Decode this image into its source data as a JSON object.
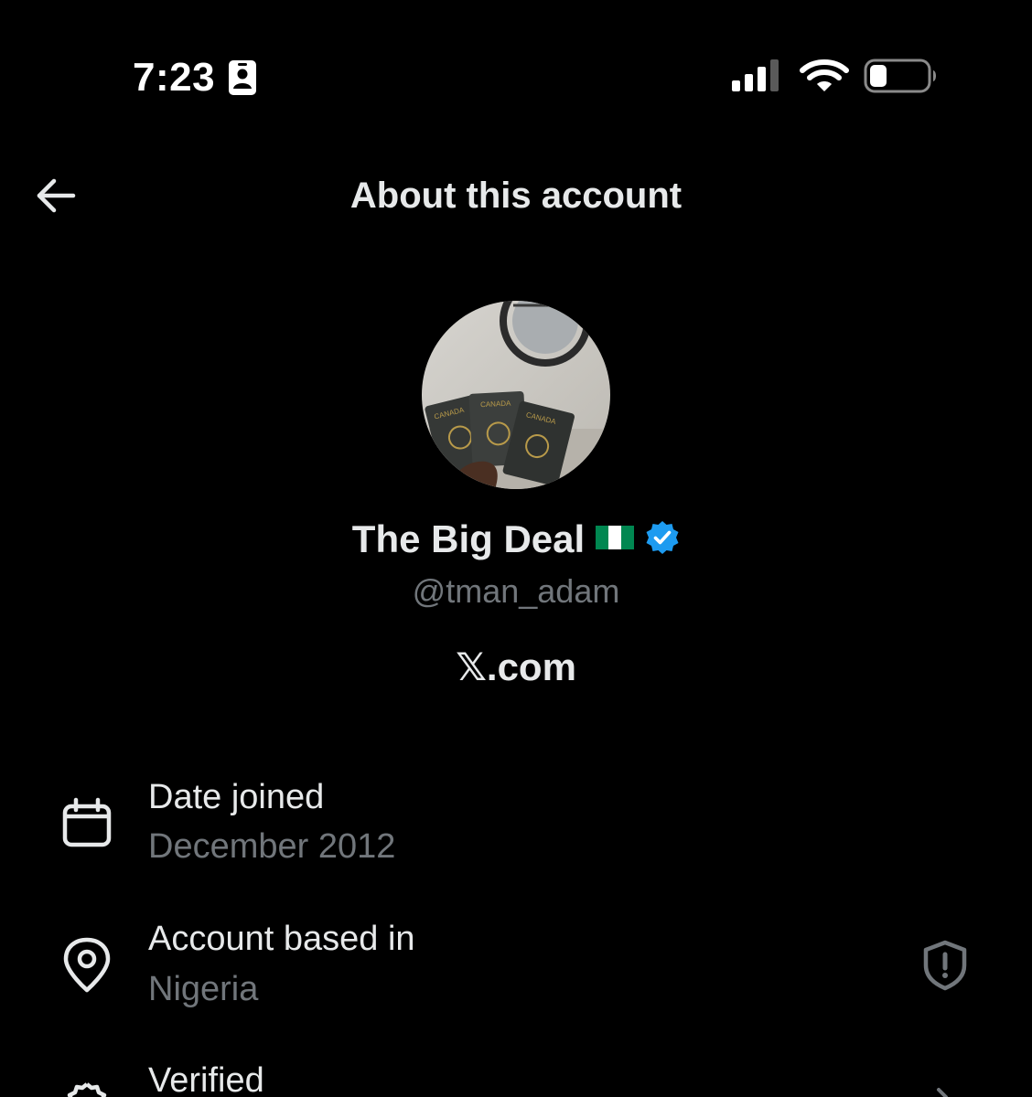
{
  "status_bar": {
    "time": "7:23",
    "focus_icon": "person-card-icon",
    "signal_icon": "cellular-signal-icon",
    "wifi_icon": "wifi-icon",
    "battery_icon": "battery-low-icon"
  },
  "header": {
    "back_icon": "arrow-left-icon",
    "title": "About this account"
  },
  "profile": {
    "display_name": "The Big Deal",
    "flag": "🇳🇬",
    "verified_badge": "verified-badge-icon",
    "handle": "@tman_adam",
    "source": "𝕏.com"
  },
  "info": {
    "date_joined": {
      "icon": "calendar-icon",
      "label": "Date joined",
      "value": "December 2012"
    },
    "based_in": {
      "icon": "location-pin-icon",
      "label": "Account based in",
      "value": "Nigeria",
      "action_icon": "shield-alert-icon"
    },
    "verified": {
      "icon": "verified-badge-outline-icon",
      "label": "Verified",
      "action_icon": "chevron-right-icon"
    }
  },
  "colors": {
    "background": "#000000",
    "text_primary": "#e7e9ea",
    "text_secondary": "#71767b",
    "verified_blue": "#1d9bf0",
    "flag_green": "#008751"
  }
}
